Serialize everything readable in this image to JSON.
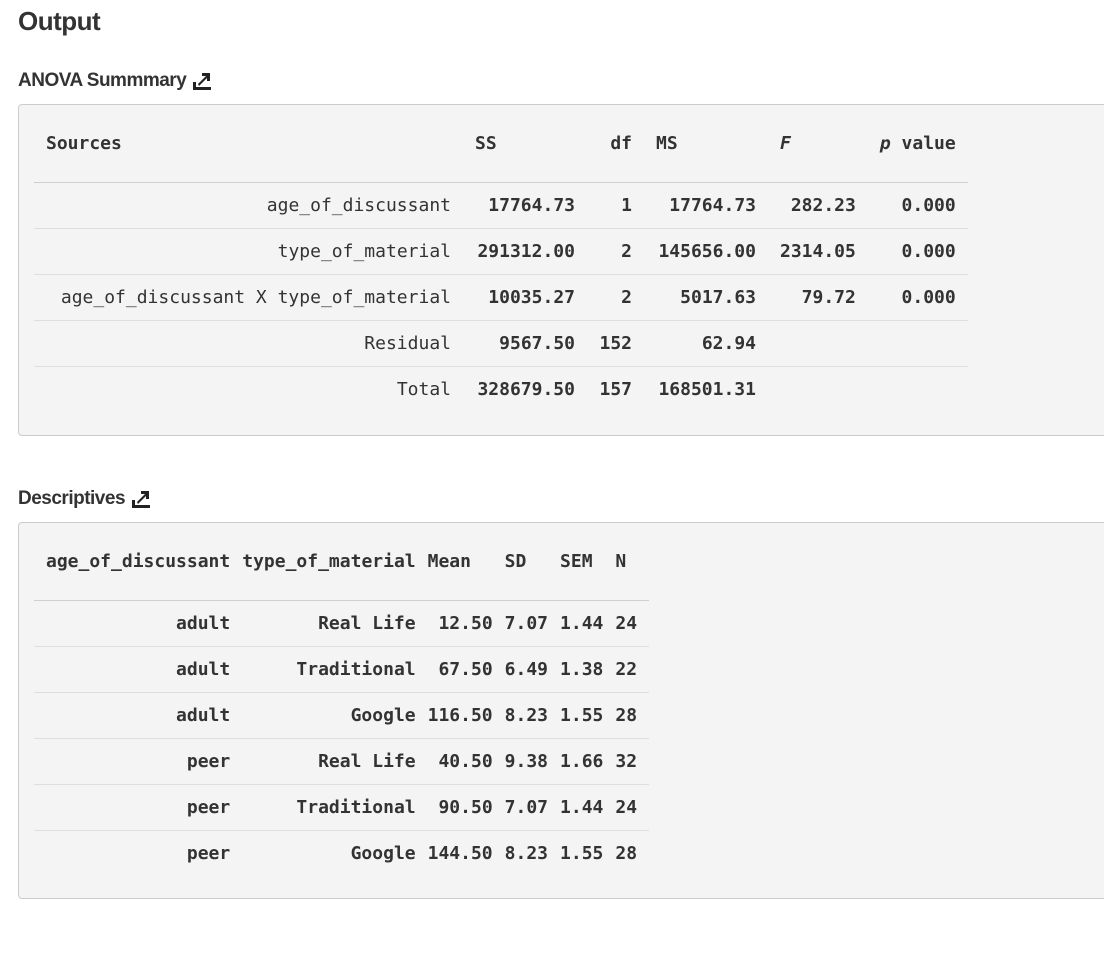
{
  "page_title": "Output",
  "anova": {
    "title": "ANOVA Summmary",
    "headers": {
      "sources": "Sources",
      "ss": "SS",
      "df": "df",
      "ms": "MS",
      "f": "F",
      "p_italic": "p",
      "p_rest": " value"
    },
    "rows": [
      {
        "source": "age_of_discussant",
        "ss": "17764.73",
        "df": "1",
        "ms": "17764.73",
        "f": "282.23",
        "p": "0.000"
      },
      {
        "source": "type_of_material",
        "ss": "291312.00",
        "df": "2",
        "ms": "145656.00",
        "f": "2314.05",
        "p": "0.000"
      },
      {
        "source": "age_of_discussant X type_of_material",
        "ss": "10035.27",
        "df": "2",
        "ms": "5017.63",
        "f": "79.72",
        "p": "0.000"
      },
      {
        "source": "Residual",
        "ss": "9567.50",
        "df": "152",
        "ms": "62.94",
        "f": "",
        "p": ""
      },
      {
        "source": "Total",
        "ss": "328679.50",
        "df": "157",
        "ms": "168501.31",
        "f": "",
        "p": ""
      }
    ]
  },
  "descriptives": {
    "title": "Descriptives",
    "headers": {
      "age": "age_of_discussant",
      "material": "type_of_material",
      "mean": "Mean",
      "sd": "SD",
      "sem": "SEM",
      "n": "N"
    },
    "rows": [
      {
        "age": "adult",
        "material": "Real Life",
        "mean": "12.50",
        "sd": "7.07",
        "sem": "1.44",
        "n": "24"
      },
      {
        "age": "adult",
        "material": "Traditional",
        "mean": "67.50",
        "sd": "6.49",
        "sem": "1.38",
        "n": "22"
      },
      {
        "age": "adult",
        "material": "Google",
        "mean": "116.50",
        "sd": "8.23",
        "sem": "1.55",
        "n": "28"
      },
      {
        "age": "peer",
        "material": "Real Life",
        "mean": "40.50",
        "sd": "9.38",
        "sem": "1.66",
        "n": "32"
      },
      {
        "age": "peer",
        "material": "Traditional",
        "mean": "90.50",
        "sd": "7.07",
        "sem": "1.44",
        "n": "24"
      },
      {
        "age": "peer",
        "material": "Google",
        "mean": "144.50",
        "sd": "8.23",
        "sem": "1.55",
        "n": "28"
      }
    ]
  },
  "icons": {
    "export": "export-icon"
  },
  "colors": {
    "panel_bg": "#f4f4f4",
    "panel_border": "#cccccc",
    "text": "#333333"
  }
}
